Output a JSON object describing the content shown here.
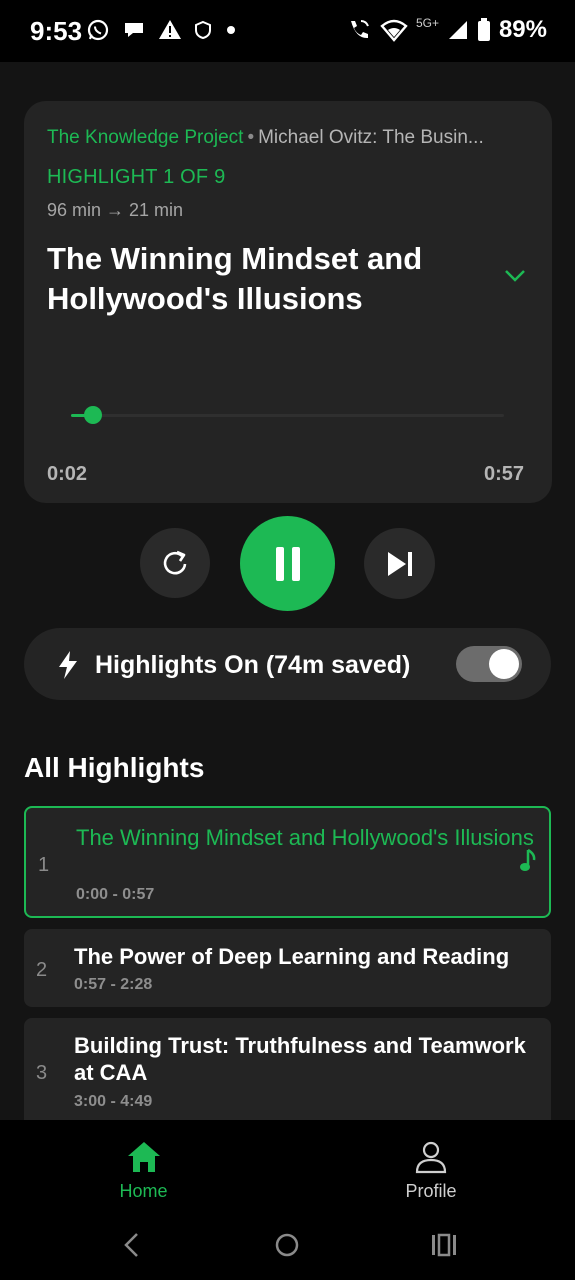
{
  "status_bar": {
    "time": "9:53",
    "network": "5G+",
    "battery": "89%"
  },
  "player": {
    "podcast": "The Knowledge Project",
    "separator": "•",
    "episode": "Michael Ovitz: The Busin...",
    "highlight_index": "HIGHLIGHT 1 OF 9",
    "duration": "96 min → 21 min",
    "title": "The Winning Mindset and Hollywood's Illusions",
    "time_start": "0:02",
    "time_end": "0:57",
    "progress_fraction": 0.05
  },
  "controls": {
    "replay_icon": "replay-icon",
    "play_pause_icon": "pause-icon",
    "next_icon": "skip-next-icon"
  },
  "highlights_toggle": {
    "label": "Highlights On (74m saved)",
    "enabled": true
  },
  "highlights": {
    "section_title": "All Highlights",
    "items": [
      {
        "num": "1",
        "title": "The Winning Mindset and Hollywood's Illusions",
        "time": "0:00 - 0:57",
        "active": true
      },
      {
        "num": "2",
        "title": "The Power of Deep Learning and Reading",
        "time": "0:57  - 2:28",
        "active": false
      },
      {
        "num": "3",
        "title": "Building Trust: Truthfulness and Teamwork at CAA",
        "time": "3:00  - 4:49",
        "active": false
      }
    ]
  },
  "bottom_nav": {
    "home": "Home",
    "profile": "Profile"
  },
  "colors": {
    "accent": "#1db954",
    "background": "#141414",
    "card": "#242424"
  }
}
